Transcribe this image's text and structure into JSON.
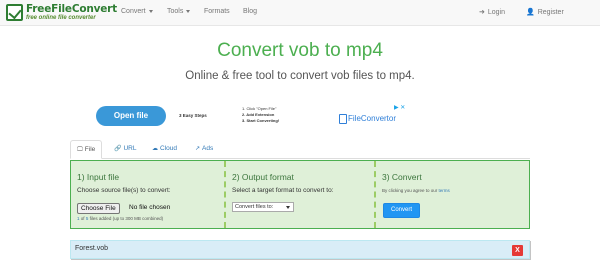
{
  "nav": {
    "logo_name": "FreeFileConvert",
    "logo_tagline": "free online file converter",
    "menu": [
      {
        "label": "Convert",
        "dropdown": true
      },
      {
        "label": "Tools",
        "dropdown": true
      },
      {
        "label": "Formats",
        "dropdown": false
      },
      {
        "label": "Blog",
        "dropdown": false
      }
    ],
    "login": "Login",
    "register": "Register"
  },
  "hero": {
    "title": "Convert vob to mp4",
    "subtitle": "Online & free tool to convert vob files to mp4."
  },
  "ad": {
    "button": "Open file",
    "steps_title": "3 Easy Steps",
    "steps": [
      "1. Click \"Open File\"",
      "2. Add Extension",
      "3. Start Converting!"
    ],
    "brand": "FileConvertor",
    "close": "▶ ✕"
  },
  "tabs": [
    {
      "label": "File",
      "active": true,
      "icon": "monitor-icon"
    },
    {
      "label": "URL",
      "active": false,
      "icon": "link-icon"
    },
    {
      "label": "Cloud",
      "active": false,
      "icon": "cloud-icon"
    },
    {
      "label": "Ads",
      "active": false,
      "icon": "external-link-icon"
    }
  ],
  "converter": {
    "input": {
      "heading": "1) Input file",
      "prompt": "Choose source file(s) to convert:",
      "choose_button": "Choose File",
      "status": "No file chosen",
      "count_current": "1",
      "count_of": "of",
      "count_max": "5",
      "count_note": "files added (up to 300 MB combined)"
    },
    "output": {
      "heading": "2) Output format",
      "prompt": "Select a target format to convert to:",
      "select_value": "Convert files to:"
    },
    "convert": {
      "heading": "3) Convert",
      "agree_text": "By clicking you agree to our",
      "terms_link": "terms",
      "button": "Convert"
    }
  },
  "files": [
    {
      "name": "Forest.vob",
      "remove": "X"
    }
  ],
  "colors": {
    "brand_green": "#4caf50",
    "panel_bg": "#dff0d8",
    "convert_blue": "#2196f3",
    "remove_red": "#e53935",
    "file_row_bg": "#d9edf7"
  }
}
